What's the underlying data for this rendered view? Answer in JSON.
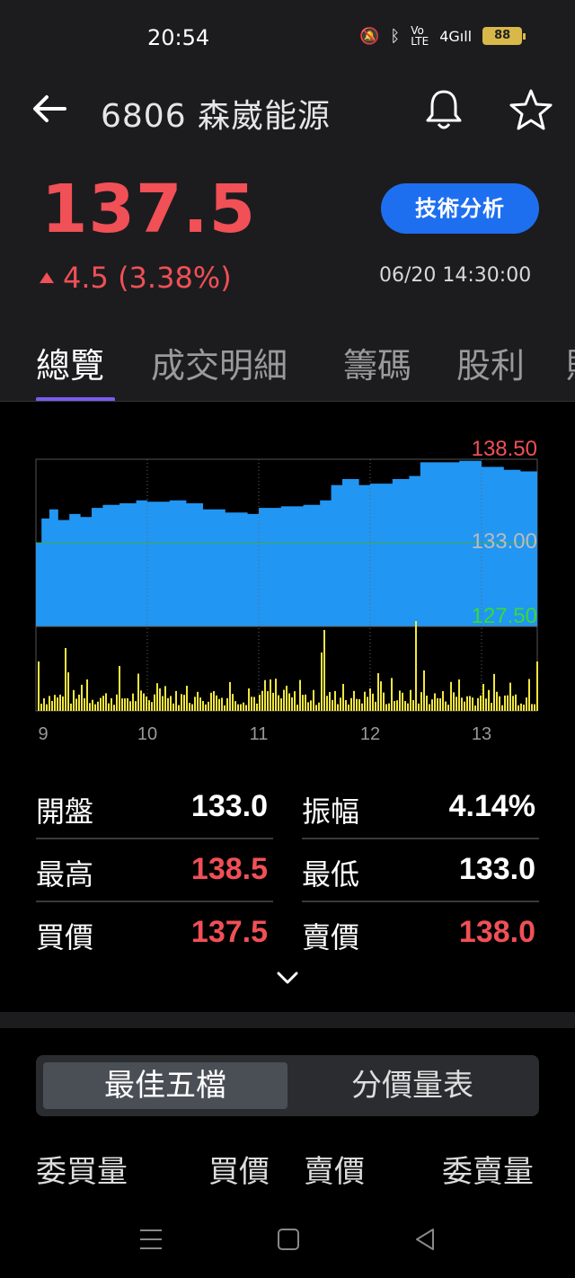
{
  "status_bar": {
    "time": "20:54",
    "battery": "88",
    "network": "4G"
  },
  "header": {
    "title": "6806 森崴能源",
    "price": "137.5",
    "change": "4.5 (3.38%)",
    "timestamp": "06/20 14:30:00",
    "ta_button": "技術分析"
  },
  "tabs": [
    {
      "label": "總覽",
      "active": true
    },
    {
      "label": "成交明細",
      "active": false
    },
    {
      "label": "籌碼",
      "active": false
    },
    {
      "label": "股利",
      "active": false
    },
    {
      "label": "財",
      "active": false
    }
  ],
  "stats": [
    {
      "l1": "開盤",
      "v1": "133.0",
      "c1": "#ffffff",
      "l2": "振幅",
      "v2": "4.14%",
      "c2": "#ffffff"
    },
    {
      "l1": "最高",
      "v1": "138.5",
      "c1": "#f05056",
      "l2": "最低",
      "v2": "133.0",
      "c2": "#ffffff"
    },
    {
      "l1": "買價",
      "v1": "137.5",
      "c1": "#f05056",
      "l2": "賣價",
      "v2": "138.0",
      "c2": "#f05056"
    }
  ],
  "segments": {
    "best_five": "最佳五檔",
    "price_volume": "分價量表"
  },
  "order_book_headers": {
    "bid_vol": "委買量",
    "bid": "買價",
    "ask": "賣價",
    "ask_vol": "委賣量"
  },
  "colors": {
    "up": "#f05056",
    "down": "#2ecc40",
    "area": "#2196f3",
    "volume": "#f2e640",
    "accent": "#1e6ff0",
    "tab_indicator": "#7a5cf0"
  },
  "chart_data": {
    "type": "area",
    "y_labels": {
      "high": "138.50",
      "ref": "133.00",
      "low": "127.50"
    },
    "ylim": [
      127.5,
      138.5
    ],
    "x_ticks": [
      "9",
      "10",
      "11",
      "12",
      "13"
    ],
    "x_tick_hours": [
      9,
      10,
      11,
      12,
      13
    ],
    "time_range": [
      9.0,
      13.5
    ],
    "price_series": [
      [
        9.0,
        133.0
      ],
      [
        9.05,
        134.6
      ],
      [
        9.12,
        135.2
      ],
      [
        9.2,
        134.5
      ],
      [
        9.3,
        134.9
      ],
      [
        9.4,
        134.7
      ],
      [
        9.5,
        135.3
      ],
      [
        9.6,
        135.5
      ],
      [
        9.75,
        135.6
      ],
      [
        9.9,
        135.8
      ],
      [
        10.0,
        135.7
      ],
      [
        10.2,
        135.8
      ],
      [
        10.35,
        135.6
      ],
      [
        10.5,
        135.2
      ],
      [
        10.7,
        135.0
      ],
      [
        10.9,
        134.9
      ],
      [
        11.0,
        135.3
      ],
      [
        11.2,
        135.4
      ],
      [
        11.4,
        135.5
      ],
      [
        11.55,
        135.8
      ],
      [
        11.65,
        136.8
      ],
      [
        11.75,
        137.2
      ],
      [
        11.9,
        136.8
      ],
      [
        12.0,
        136.9
      ],
      [
        12.2,
        137.2
      ],
      [
        12.35,
        137.4
      ],
      [
        12.45,
        138.3
      ],
      [
        12.6,
        138.3
      ],
      [
        12.8,
        138.4
      ],
      [
        13.0,
        138.0
      ],
      [
        13.2,
        137.8
      ],
      [
        13.35,
        137.7
      ],
      [
        13.5,
        137.6
      ]
    ],
    "volume_peaks": [
      [
        9.02,
        55
      ],
      [
        9.25,
        70
      ],
      [
        9.45,
        35
      ],
      [
        9.75,
        50
      ],
      [
        10.1,
        25
      ],
      [
        10.35,
        28
      ],
      [
        10.6,
        22
      ],
      [
        10.9,
        25
      ],
      [
        11.1,
        35
      ],
      [
        11.25,
        28
      ],
      [
        11.55,
        65
      ],
      [
        11.58,
        90
      ],
      [
        11.75,
        30
      ],
      [
        12.0,
        25
      ],
      [
        12.25,
        20
      ],
      [
        12.4,
        100
      ],
      [
        12.48,
        45
      ],
      [
        12.8,
        35
      ],
      [
        13.0,
        30
      ],
      [
        13.5,
        55
      ]
    ]
  }
}
